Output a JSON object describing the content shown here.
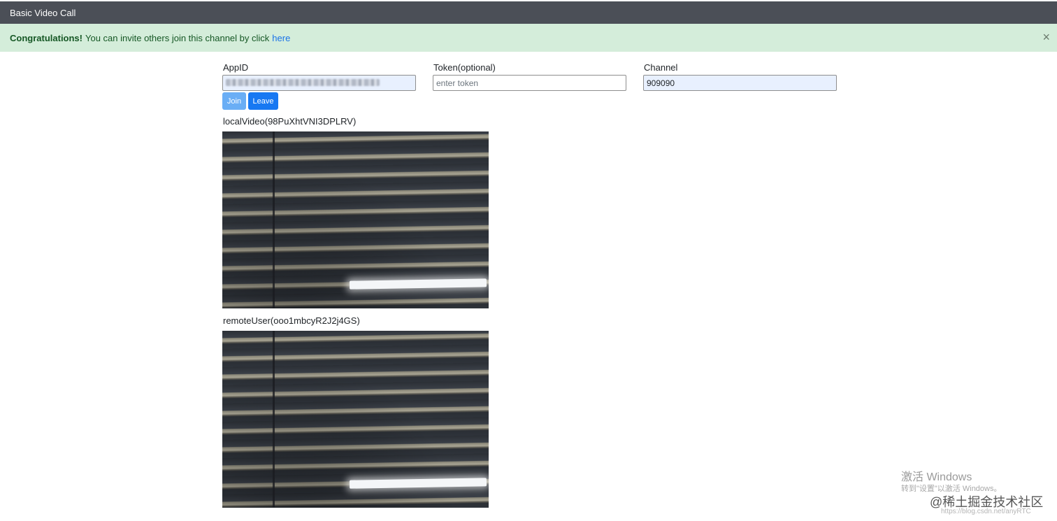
{
  "navbar": {
    "title": "Basic Video Call"
  },
  "alert": {
    "strong": "Congratulations!",
    "message": "You can invite others join this channel by click",
    "link": "here",
    "close": "×"
  },
  "form": {
    "appid": {
      "label": "AppID",
      "value": "",
      "placeholder": ""
    },
    "token": {
      "label": "Token(optional)",
      "value": "",
      "placeholder": "enter token"
    },
    "channel": {
      "label": "Channel",
      "value": "909090",
      "placeholder": ""
    }
  },
  "buttons": {
    "join": "Join",
    "leave": "Leave"
  },
  "local_video": {
    "label": "localVideo(98PuXhtVNI3DPLRV)"
  },
  "remote_video": {
    "label": "remoteUser(ooo1mbcyR2J2j4GS)"
  },
  "watermarks": {
    "windows_title": "激活 Windows",
    "windows_sub": "转到\"设置\"以激活 Windows。",
    "juejin": "@稀土掘金技术社区",
    "url": "https://blog.csdn.net/anyRTC"
  }
}
